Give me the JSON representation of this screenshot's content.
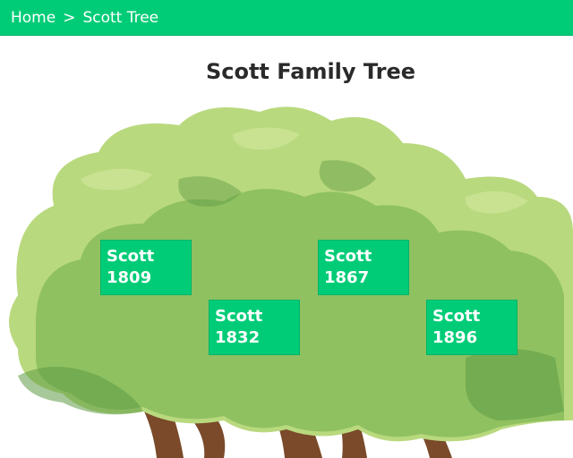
{
  "breadcrumb": {
    "home": "Home",
    "separator": ">",
    "current": "Scott Tree"
  },
  "page": {
    "title": "Scott Family Tree"
  },
  "members": [
    {
      "surname": "Scott",
      "year": "1809"
    },
    {
      "surname": "Scott",
      "year": "1832"
    },
    {
      "surname": "Scott",
      "year": "1867"
    },
    {
      "surname": "Scott",
      "year": "1896"
    }
  ],
  "colors": {
    "accent": "#00cc77",
    "foliage_light": "#b9d97e",
    "foliage_mid": "#8fc161",
    "foliage_dark": "#5f9a45",
    "trunk": "#7a4a2a"
  }
}
